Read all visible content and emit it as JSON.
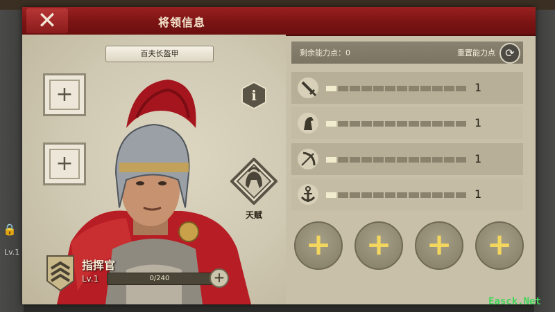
{
  "header": {
    "title": "将领信息"
  },
  "equipment": {
    "armor_name": "百夫长盔甲"
  },
  "talent": {
    "label": "天赋"
  },
  "commander": {
    "rank_title": "指挥官",
    "level": "Lv.1",
    "xp_text": "0/240",
    "xp_progress": 0
  },
  "points": {
    "remaining_label": "剩余能力点：",
    "remaining_value": "0",
    "reset_label": "重置能力点"
  },
  "stats": [
    {
      "icon": "sword-icon",
      "value": "1",
      "level_fraction": 0.1
    },
    {
      "icon": "horse-icon",
      "value": "1",
      "level_fraction": 0.1
    },
    {
      "icon": "bow-icon",
      "value": "1",
      "level_fraction": 0.1
    },
    {
      "icon": "anchor-icon",
      "value": "1",
      "level_fraction": 0.1
    }
  ],
  "background": {
    "level_text": "Lv.1"
  },
  "watermark": "Easck.Net",
  "colors": {
    "header_red": "#7b1414",
    "panel_bg": "#c8c0a8",
    "plus_gold": "#f3d65d",
    "bar_fill": "#f2eccf"
  }
}
